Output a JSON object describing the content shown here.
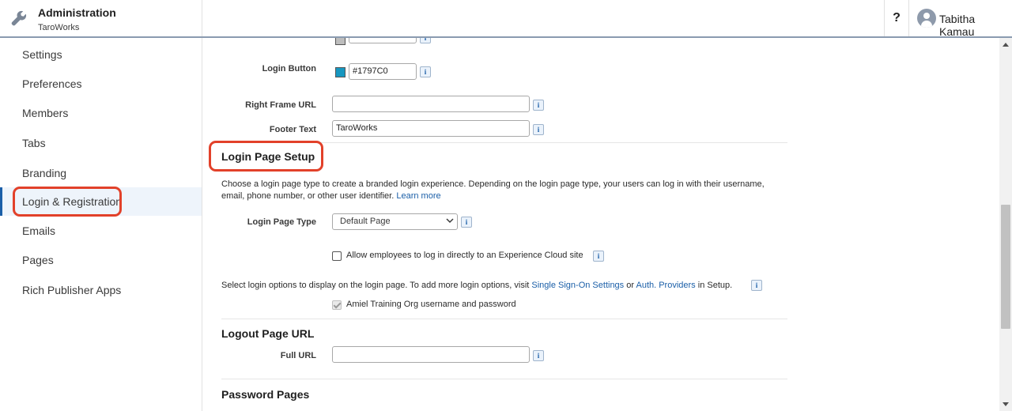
{
  "header": {
    "title": "Administration",
    "subtitle": "TaroWorks",
    "help_label": "?",
    "user_name": "Tabitha Kamau",
    "icons": {
      "app": "wrench-icon",
      "user": "avatar-icon"
    }
  },
  "sidebar": {
    "items": [
      {
        "label": "Settings"
      },
      {
        "label": "Preferences"
      },
      {
        "label": "Members"
      },
      {
        "label": "Tabs"
      },
      {
        "label": "Branding"
      },
      {
        "label": "Login & Registration",
        "active": true
      },
      {
        "label": "Emails"
      },
      {
        "label": "Pages"
      },
      {
        "label": "Rich Publisher Apps"
      }
    ]
  },
  "branding": {
    "login_button_label": "Login Button",
    "login_button_color": "#1797C0",
    "right_frame_url_label": "Right Frame URL",
    "right_frame_url_value": "",
    "footer_text_label": "Footer Text",
    "footer_text_value": "TaroWorks"
  },
  "login_setup": {
    "title": "Login Page Setup",
    "description": "Choose a login page type to create a branded login experience. Depending on the login page type, your users can log in with their username,",
    "description_line2": "email, phone number, or other user identifier.",
    "learn_more": "Learn more",
    "page_type_label": "Login Page Type",
    "page_type_value": "Default Page",
    "allow_employees_label": "Allow employees to log in directly to an Experience Cloud site",
    "allow_employees_checked": false,
    "options_text_pre": "Select login options to display on the login page. To add more login options, visit",
    "sso_link": "Single Sign-On Settings",
    "or_text": "or",
    "auth_link": "Auth. Providers",
    "in_setup_text": "in Setup.",
    "org_login_label": "Amiel Training Org username and password",
    "org_login_checked": true
  },
  "logout": {
    "title": "Logout Page URL",
    "full_url_label": "Full URL",
    "full_url_value": ""
  },
  "password": {
    "title": "Password Pages"
  },
  "info_icon_glyph": "i",
  "colors": {
    "accent": "#1b5fa8",
    "highlight": "#e2412a",
    "active_bg": "#eef4fb"
  }
}
